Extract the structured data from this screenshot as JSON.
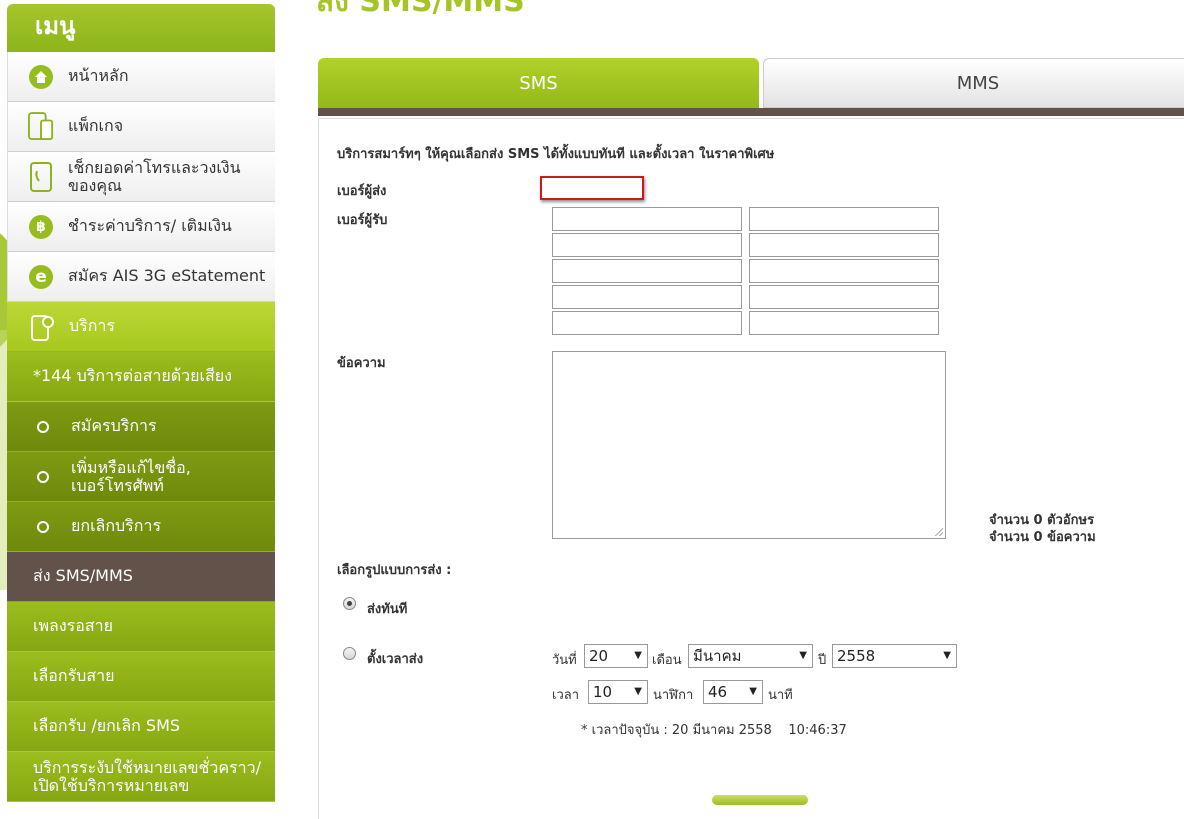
{
  "page_title": "ส่ง SMS/MMS",
  "sidebar": {
    "header": "เมนู",
    "items": [
      {
        "label": "หน้าหลัก",
        "icon": "home-icon"
      },
      {
        "label": "แพ็กเกจ",
        "icon": "tablet-phone-icon"
      },
      {
        "label": "เช็กยอดค่าโทรและวงเงินของคุณ",
        "line1": "เช็กยอดค่าโทรและวงเงิน",
        "line2": "ของคุณ",
        "icon": "phone-bill-icon"
      },
      {
        "label": "ชำระค่าบริการ/ เติมเงิน",
        "icon": "baht-icon",
        "glyph": "฿"
      },
      {
        "label": "สมัคร AIS 3G eStatement",
        "icon": "e-statement-icon",
        "glyph": "e"
      },
      {
        "label": "บริการ",
        "icon": "service-phone-icon"
      },
      {
        "label": "*144 บริการต่อสายด้วยเสียง"
      },
      {
        "label": "สมัครบริการ"
      },
      {
        "label": "เพิ่มหรือแก้ไขชื่อ, เบอร์โทรศัพท์",
        "line1": "เพิ่มหรือแก้ไขชื่อ,",
        "line2": "เบอร์โทรศัพท์"
      },
      {
        "label": "ยกเลิกบริการ"
      },
      {
        "label": "ส่ง SMS/MMS"
      },
      {
        "label": "เพลงรอสาย"
      },
      {
        "label": "เลือกรับสาย"
      },
      {
        "label": "เลือกรับ /ยกเลิก SMS"
      },
      {
        "label": "บริการระงับใช้หมายเลขชั่วคราว/เปิดใช้บริการหมายเลข",
        "line1": "บริการระงับใช้หมายเลขชั่วคราว/",
        "line2": "เปิดใช้บริการหมายเลข"
      }
    ]
  },
  "tabs": {
    "sms": "SMS",
    "mms": "MMS"
  },
  "form": {
    "intro_prefix": "บริการสมาร์ทๆ ให้คุณเลือกส่ง ",
    "intro_sms": "SMS",
    "intro_suffix": " ได้ทั้งแบบทันที และตั้งเวลา ในราคาพิเศษ",
    "sender_label": "เบอร์ผู้ส่ง",
    "sender_value": "",
    "receiver_label": "เบอร์ผู้รับ",
    "message_label": "ข้อความ",
    "char_count_prefix": "จำนวน",
    "char_count": "0",
    "char_count_suffix": "ตัวอักษร",
    "msg_count_prefix": "จำนวน",
    "msg_count": "0",
    "msg_count_suffix": "ข้อความ",
    "send_mode_label": "เลือกรูปแบบการส่ง :",
    "send_now_label": "ส่งทันที",
    "send_now_checked": true,
    "schedule_label": "ตั้งเวลาส่ง",
    "schedule_checked": false,
    "day_label": "วันที่",
    "day_value": "20",
    "month_label": "เดือน",
    "month_value": "มีนาคม",
    "year_label": "ปี",
    "year_value": "2558",
    "time_label": "เวลา",
    "hour_value": "10",
    "minute_label": "นาฬิกา",
    "minute_value": "46",
    "minute_unit": "นาที",
    "current_time": "* เวลาปัจจุบัน : 20 มีนาคม 2558    10:46:37"
  },
  "colors": {
    "accent_green": "#a4c524",
    "active_brown": "#62524a",
    "highlight_red": "#cc1b1b"
  }
}
